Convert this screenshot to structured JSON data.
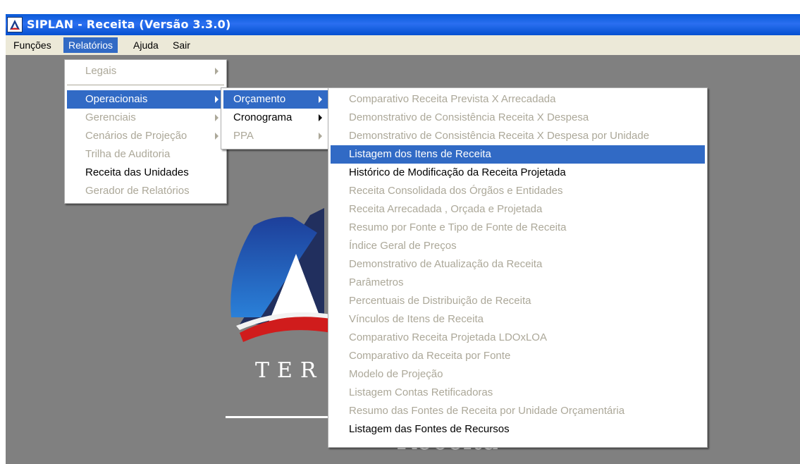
{
  "window": {
    "title": "SIPLAN - Receita (Versão 3.3.0)"
  },
  "menubar": {
    "items": [
      {
        "label": "Funções"
      },
      {
        "label": "Relatórios"
      },
      {
        "label": "Ajuda"
      },
      {
        "label": "Sair"
      }
    ]
  },
  "relatorios_menu": {
    "items": [
      {
        "label": "Legais",
        "disabled": true,
        "submenu": true
      },
      {
        "label": "Operacionais",
        "disabled": false,
        "submenu": true,
        "selected": true
      },
      {
        "label": "Gerenciais",
        "disabled": true,
        "submenu": true
      },
      {
        "label": "Cenários de Projeção",
        "disabled": true,
        "submenu": true
      },
      {
        "label": "Trilha de Auditoria",
        "disabled": true
      },
      {
        "label": "Receita das Unidades",
        "disabled": false
      },
      {
        "label": "Gerador de Relatórios",
        "disabled": true
      }
    ]
  },
  "operacionais_menu": {
    "items": [
      {
        "label": "Orçamento",
        "selected": true,
        "submenu": true
      },
      {
        "label": "Cronograma",
        "submenu": true
      },
      {
        "label": "PPA",
        "disabled": true,
        "submenu": true
      }
    ]
  },
  "orcamento_menu": {
    "items": [
      {
        "label": "Comparativo Receita Prevista X Arrecadada",
        "disabled": true
      },
      {
        "label": "Demonstrativo de Consistência Receita X Despesa",
        "disabled": true
      },
      {
        "label": "Demonstrativo de Consistência Receita X Despesa por Unidade",
        "disabled": true
      },
      {
        "label": "Listagem dos Itens de Receita",
        "selected": true
      },
      {
        "label": "Histórico de Modificação da Receita Projetada",
        "disabled": false
      },
      {
        "label": "Receita Consolidada dos Órgãos e Entidades",
        "disabled": true
      },
      {
        "label": "Receita Arrecadada , Orçada e Projetada",
        "disabled": true
      },
      {
        "label": "Resumo por Fonte e Tipo de Fonte de Receita",
        "disabled": true
      },
      {
        "label": "Índice Geral de Preços",
        "disabled": true
      },
      {
        "label": "Demonstrativo de Atualização da Receita",
        "disabled": true
      },
      {
        "label": "Parâmetros",
        "disabled": true
      },
      {
        "label": "Percentuais de Distribuição de Receita",
        "disabled": true
      },
      {
        "label": "Vínculos de Itens de Receita",
        "disabled": true
      },
      {
        "label": "Comparativo Receita Projetada LDOxLOA",
        "disabled": true
      },
      {
        "label": "Comparativo da Receita por Fonte",
        "disabled": true
      },
      {
        "label": "Modelo de Projeção",
        "disabled": true
      },
      {
        "label": "Listagem Contas Retificadoras",
        "disabled": true
      },
      {
        "label": "Resumo das Fontes de Receita por Unidade Orçamentária",
        "disabled": true
      },
      {
        "label": "Listagem das Fontes de Recursos",
        "disabled": false
      }
    ]
  },
  "background_logo": {
    "word": "TER",
    "subtitle": "Receita"
  },
  "colors": {
    "titlebar": "#0a5ad8",
    "selection": "#316ac5",
    "menubar": "#ece9d8",
    "client": "#808080",
    "disabled_text": "#aca899"
  },
  "icons": {
    "app": "siplan-logo-icon",
    "submenu": "triangle-right-icon"
  }
}
